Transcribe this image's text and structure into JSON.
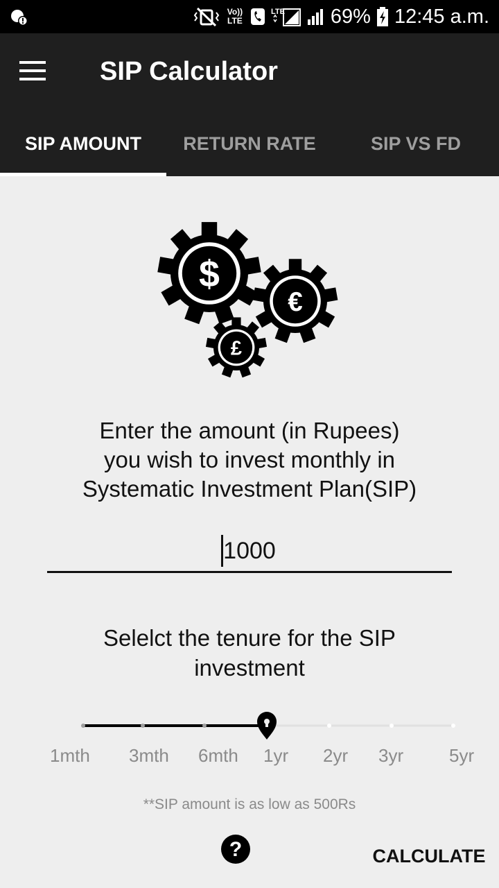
{
  "status_bar": {
    "battery": "69%",
    "time": "12:45 a.m.",
    "volte": "Vo)) LTE",
    "lte": "LTE"
  },
  "app_bar": {
    "title": "SIP Calculator",
    "menu_icon": "hamburger-menu-icon"
  },
  "tabs": [
    {
      "label": "SIP AMOUNT",
      "active": true
    },
    {
      "label": "RETURN RATE",
      "active": false
    },
    {
      "label": "SIP VS FD",
      "active": false
    }
  ],
  "main": {
    "illustration": "currency-gears-icon",
    "prompt_lines": [
      "Enter the amount (in Rupees)",
      "you wish to invest monthly in",
      "Systematic Investment Plan(SIP)"
    ],
    "amount_value": "1000",
    "tenure_lines": [
      "Selelct the tenure for the SIP",
      "investment"
    ],
    "tenure_options": [
      "1mth",
      "3mth",
      "6mth",
      "1yr",
      "2yr",
      "3yr",
      "5yr"
    ],
    "tenure_selected": "1yr",
    "note": "**SIP amount is as low as 500Rs",
    "help_icon": "help-circle-icon",
    "calculate_label": "CALCULATE"
  }
}
